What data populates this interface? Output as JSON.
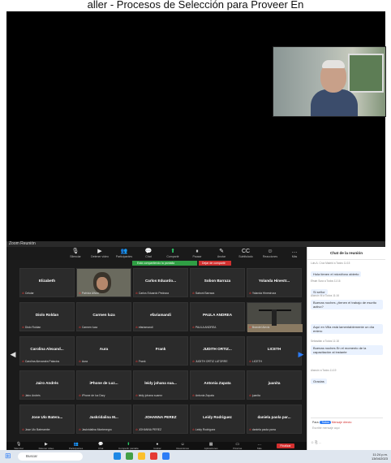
{
  "banner": {
    "text": "aller - Procesos de Selección para Proveer En"
  },
  "window": {
    "title": "Zoom Reunión"
  },
  "toolbar": {
    "items": [
      {
        "label": "Silenciar",
        "icon": "mic-icon"
      },
      {
        "label": "Detener video",
        "icon": "video-icon"
      },
      {
        "label": "Participantes",
        "icon": "participants-icon"
      },
      {
        "label": "Chat",
        "icon": "chat-icon"
      },
      {
        "label": "Compartir",
        "icon": "share-icon"
      },
      {
        "label": "Pausar",
        "icon": "pause-icon"
      },
      {
        "label": "Anotar",
        "icon": "annotate-icon"
      },
      {
        "label": "Subtitulado",
        "icon": "cc-icon"
      },
      {
        "label": "Reacciones",
        "icon": "react-icon"
      },
      {
        "label": "Más",
        "icon": "more-icon"
      }
    ]
  },
  "recording": {
    "green": "Está compartiendo la pantalla",
    "red": "Dejar de compartir"
  },
  "tiles": [
    {
      "name": "Elizabeth",
      "sub": "Celular",
      "kind": "plain"
    },
    {
      "name": "",
      "sub": "Patricia Alfaro",
      "kind": "video"
    },
    {
      "name": "Carlos Eduardo...",
      "sub": "Carlos Eduardo Pedraza",
      "kind": "plain"
    },
    {
      "name": "Sobon Barraza",
      "sub": "Saboni Barraza",
      "kind": "plain"
    },
    {
      "name": "Yolanda Hinestr...",
      "sub": "Yolanda Hinestroza",
      "kind": "plain"
    },
    {
      "name": "Diolo Roldan",
      "sub": "Diolo Roldan",
      "kind": "plain"
    },
    {
      "name": "Carmen luza",
      "sub": "Carmen luza",
      "kind": "plain"
    },
    {
      "name": "efariamandi",
      "sub": "efariamandi",
      "kind": "plain"
    },
    {
      "name": "PAULA ANDREA",
      "sub": "PAULA ANDREA",
      "kind": "plain"
    },
    {
      "name": "",
      "sub": "Brandel Alexis",
      "kind": "gym"
    },
    {
      "name": "Carolina Alexand...",
      "sub": "Carolina Alexandra Palacios",
      "kind": "plain"
    },
    {
      "name": "Aura",
      "sub": "Aura",
      "kind": "plain"
    },
    {
      "name": "Frank",
      "sub": "Frank",
      "kind": "plain"
    },
    {
      "name": "JUDITH ORTIZ...",
      "sub": "JUDITH ORTIZ LATORRE",
      "kind": "plain"
    },
    {
      "name": "LICETH",
      "sub": "LICETH",
      "kind": "plain"
    },
    {
      "name": "Jairo Andrés",
      "sub": "Jairo Andrés",
      "kind": "plain"
    },
    {
      "name": "iPhone de Luz...",
      "sub": "iPhone de luz Dary",
      "kind": "plain"
    },
    {
      "name": "leidy johana sua...",
      "sub": "leidy johana suarez",
      "kind": "plain"
    },
    {
      "name": "Antonia Zapata",
      "sub": "Antonia Zapata",
      "kind": "plain"
    },
    {
      "name": "juanita",
      "sub": "juanita",
      "kind": "plain"
    },
    {
      "name": "Jose Ulo Batera...",
      "sub": "Jose Ulo Baterambe",
      "kind": "plain"
    },
    {
      "name": "Jaskridalina M...",
      "sub": "Jaskridalina Montenegro",
      "kind": "plain"
    },
    {
      "name": "JOHANNA PEREZ",
      "sub": "JOHANNA PEREZ",
      "kind": "plain"
    },
    {
      "name": "Leidy Rodriguez",
      "sub": "Leidy Rodriguez",
      "kind": "plain"
    },
    {
      "name": "daniela paola par...",
      "sub": "daniela paola parra",
      "kind": "plain"
    }
  ],
  "bottombar": {
    "items": [
      {
        "label": "Silenciar",
        "icon": "mic-icon"
      },
      {
        "label": "Detener video",
        "icon": "video-icon"
      },
      {
        "label": "Participantes",
        "icon": "participants-icon"
      },
      {
        "label": "Chat",
        "icon": "chat-icon"
      },
      {
        "label": "Compartir pantalla",
        "icon": "share-screen-icon"
      },
      {
        "label": "Grabar",
        "icon": "record-icon"
      },
      {
        "label": "Reacciones",
        "icon": "reactions-icon"
      },
      {
        "label": "Aplicaciones",
        "icon": "apps-icon"
      },
      {
        "label": "Pizarras",
        "icon": "whiteboard-icon"
      },
      {
        "label": "Más",
        "icon": "more-icon"
      }
    ],
    "end_label": "Finalizar"
  },
  "chat": {
    "header": "Chat de la reunión",
    "messages": [
      {
        "meta": "Luis A. Cruz Madrid a Todos 11:15",
        "text": "Hola tienen el micrófono abierto"
      },
      {
        "meta": "Efrain Sura a Todos 11:16",
        "text": "Si señor"
      },
      {
        "meta": "Alarcón M a Todos 11:16",
        "text": "Buenas noches ¿tienen el trabajo de escrito activo?"
      },
      {
        "meta": "",
        "text": "Aquí en Villa está lamentablemente un día entero"
      },
      {
        "meta": "Sebastián a Todos 11:18",
        "text": "Buenas noches En el momento de la capacitación al instante"
      },
      {
        "meta": "Alarcón a Todos 11:19",
        "text": "Gracias"
      }
    ],
    "to_label": "Para:",
    "to_value": "Todos",
    "to_extra": "Mensaje directo",
    "input_placeholder": "Escribir mensaje aquí"
  },
  "taskbar": {
    "search_label": "Buscar",
    "time": "11:24 p.m.",
    "date": "13/04/2023"
  },
  "colors": {
    "accent": "#2c7cf6",
    "record_green": "#2f9e44",
    "stop_red": "#d0302f"
  }
}
